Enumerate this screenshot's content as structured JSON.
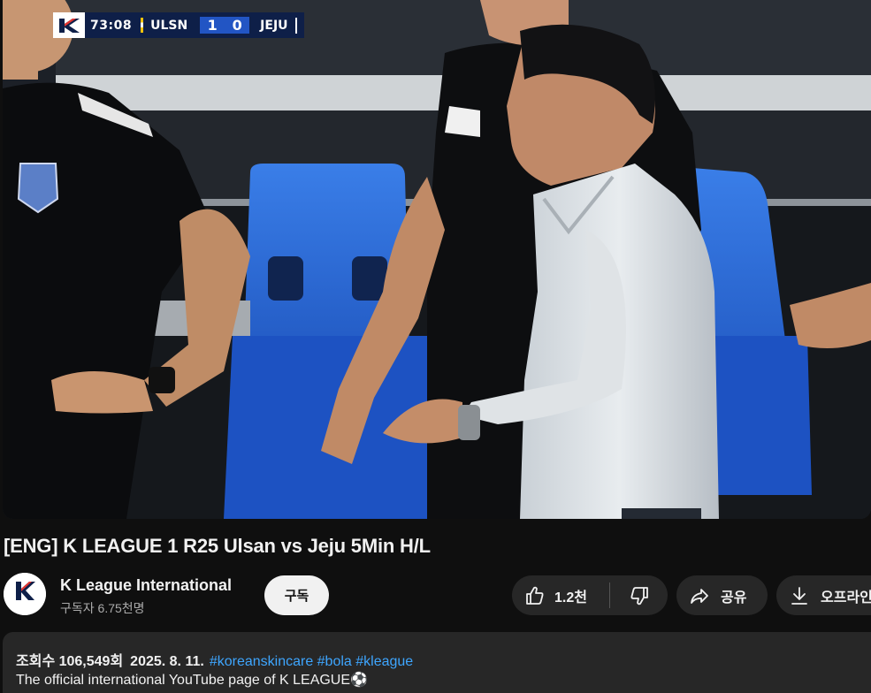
{
  "scoreboard": {
    "clock": "73:08",
    "home_team": "ULSN",
    "home_score": "1",
    "away_score": "0",
    "away_team": "JEJU"
  },
  "video": {
    "title": "[ENG] K LEAGUE 1 R25 Ulsan vs Jeju 5Min H/L"
  },
  "channel": {
    "name": "K League International",
    "subscribers": "구독자 6.75천명",
    "avatar_text": "K LEAGUE",
    "subscribe_label": "구독"
  },
  "actions": {
    "like_count": "1.2천",
    "share_label": "공유",
    "download_label": "오프라인"
  },
  "description": {
    "views": "조회수 106,549회",
    "date": "2025. 8. 11.",
    "hashtags": "#koreanskincare #bola #kleague",
    "text": "The official international YouTube page of K LEAGUE⚽"
  },
  "colors": {
    "background": "#0f0f0f",
    "pill_bg": "#272727",
    "hashtag": "#3ea6ff",
    "scoreboard_bg": "#0e1f48",
    "score_bg": "#2255c4"
  }
}
